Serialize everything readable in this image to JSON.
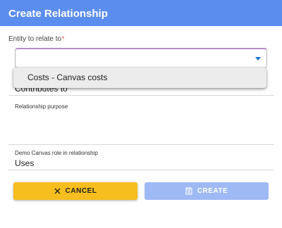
{
  "dialog": {
    "title": "Create Relationship"
  },
  "form": {
    "entity_label": "Entity to relate to",
    "required_marker": "*",
    "entity_value": "",
    "relationship_type_value": "Contributes to",
    "purpose_label": "Relationship purpose",
    "purpose_value": "",
    "role_label": "Demo Canvas role in relationship",
    "role_value": "Uses"
  },
  "dropdown": {
    "options": [
      {
        "label": "Costs - Canvas costs"
      }
    ]
  },
  "buttons": {
    "cancel_label": "CANCEL",
    "create_label": "CREATE",
    "cancel_icon": "close-icon",
    "create_icon": "save-icon",
    "create_disabled": true
  },
  "colors": {
    "header": "#5b8def",
    "cancel_button": "#f6be1e",
    "create_button_disabled": "#9fb9f5",
    "select_accent": "#b48ac8",
    "dropdown_arrow": "#1a73c8",
    "required_marker": "#e53935"
  }
}
